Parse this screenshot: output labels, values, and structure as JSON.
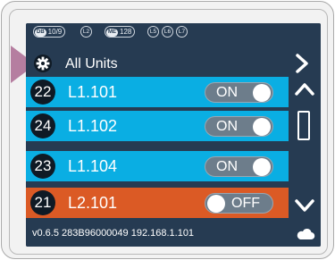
{
  "status_bar": {
    "db_cap": "DB",
    "db_value": "10/9",
    "l2": "L2",
    "me_cap": "ME",
    "me_value": "128",
    "l5": "L5",
    "l6": "L6",
    "l7": "L7"
  },
  "header": {
    "title": "All Units",
    "left_icon": "gear-icon",
    "right_icon": "chevron-right-icon"
  },
  "units": [
    {
      "number": "22",
      "label": "L1.101",
      "toggle": "ON",
      "state": "on"
    },
    {
      "number": "24",
      "label": "L1.102",
      "toggle": "ON",
      "state": "on"
    },
    {
      "number": "23",
      "label": "L1.104",
      "toggle": "ON",
      "state": "on"
    },
    {
      "number": "21",
      "label": "L2.101",
      "toggle": "OFF",
      "state": "off"
    }
  ],
  "footer": {
    "info": "v0.6.5  283B96000049  192.168.1.101",
    "icon": "cloud-icon"
  },
  "colors": {
    "screen_bg": "#263b52",
    "row_on": "#0aaee3",
    "row_off": "#db5a25",
    "pointer": "#b57ea0"
  }
}
